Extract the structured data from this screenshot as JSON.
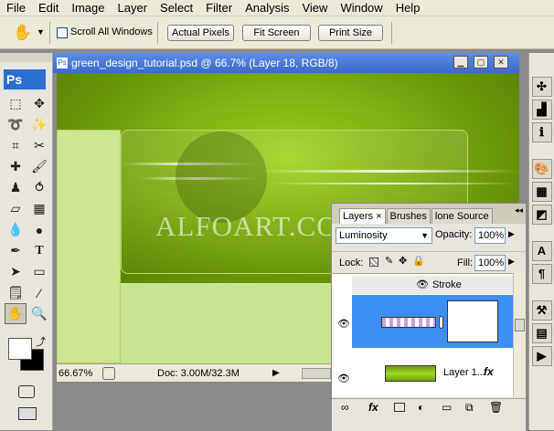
{
  "menu": [
    "File",
    "Edit",
    "Image",
    "Layer",
    "Select",
    "Filter",
    "Analysis",
    "View",
    "Window",
    "Help"
  ],
  "options": {
    "scroll_all_label": "Scroll All Windows",
    "actual_pixels": "Actual Pixels",
    "fit_screen": "Fit Screen",
    "print_size": "Print Size"
  },
  "toolbox": {
    "logo": "Ps"
  },
  "document": {
    "title": "green_design_tutorial.psd @ 66.7% (Layer 18, RGB/8)",
    "watermark": "ALFOART.COM",
    "zoom": "66.67%",
    "doc_size": "Doc: 3.00M/32.3M"
  },
  "layers_panel": {
    "tabs": [
      "Layers",
      "Brushes",
      "lone Source"
    ],
    "blend_mode": "Luminosity",
    "opacity_label": "Opacity:",
    "opacity_value": "100%",
    "lock_label": "Lock:",
    "fill_label": "Fill:",
    "fill_value": "100%",
    "effect_name": "Stroke",
    "layer_name": "Layer 1...",
    "fx": "fx"
  },
  "colors": {
    "accent": "#3c8ff5",
    "title_bar": "#3a6bc8",
    "canvas_green": "#8fc21a",
    "canvas_light": "#c9e490"
  }
}
